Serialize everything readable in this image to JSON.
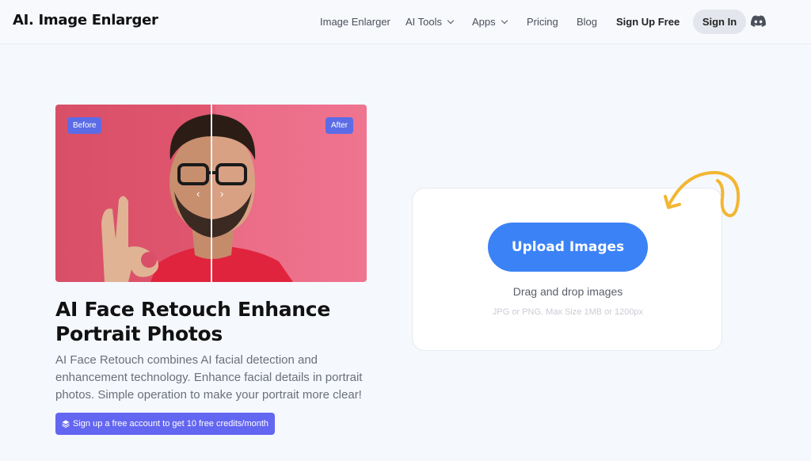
{
  "header": {
    "logo": "AI. Image Enlarger",
    "nav": [
      {
        "label": "Image Enlarger"
      },
      {
        "label": "AI Tools"
      },
      {
        "label": "Apps"
      },
      {
        "label": "Pricing"
      },
      {
        "label": "Blog"
      }
    ],
    "signup_label": "Sign Up Free",
    "signin_label": "Sign In",
    "discord_icon": "discord-icon"
  },
  "hero": {
    "before_label": "Before",
    "after_label": "After",
    "title": "AI Face Retouch Enhance Portrait Photos",
    "description": "AI Face Retouch combines AI facial detection and enhancement technology. Enhance facial details in portrait photos. Simple operation to make your portrait more clear!",
    "credits_button": "Sign up a free account to get 10 free credits/month"
  },
  "upload": {
    "button_label": "Upload Images",
    "drag_text": "Drag and drop images",
    "hint": "JPG or PNG. Max Size 1MB or 1200px"
  },
  "colors": {
    "accent": "#3b82f6",
    "badge": "#5b6ce6",
    "credit_button": "#6366f1",
    "scribble": "#f2b632"
  }
}
